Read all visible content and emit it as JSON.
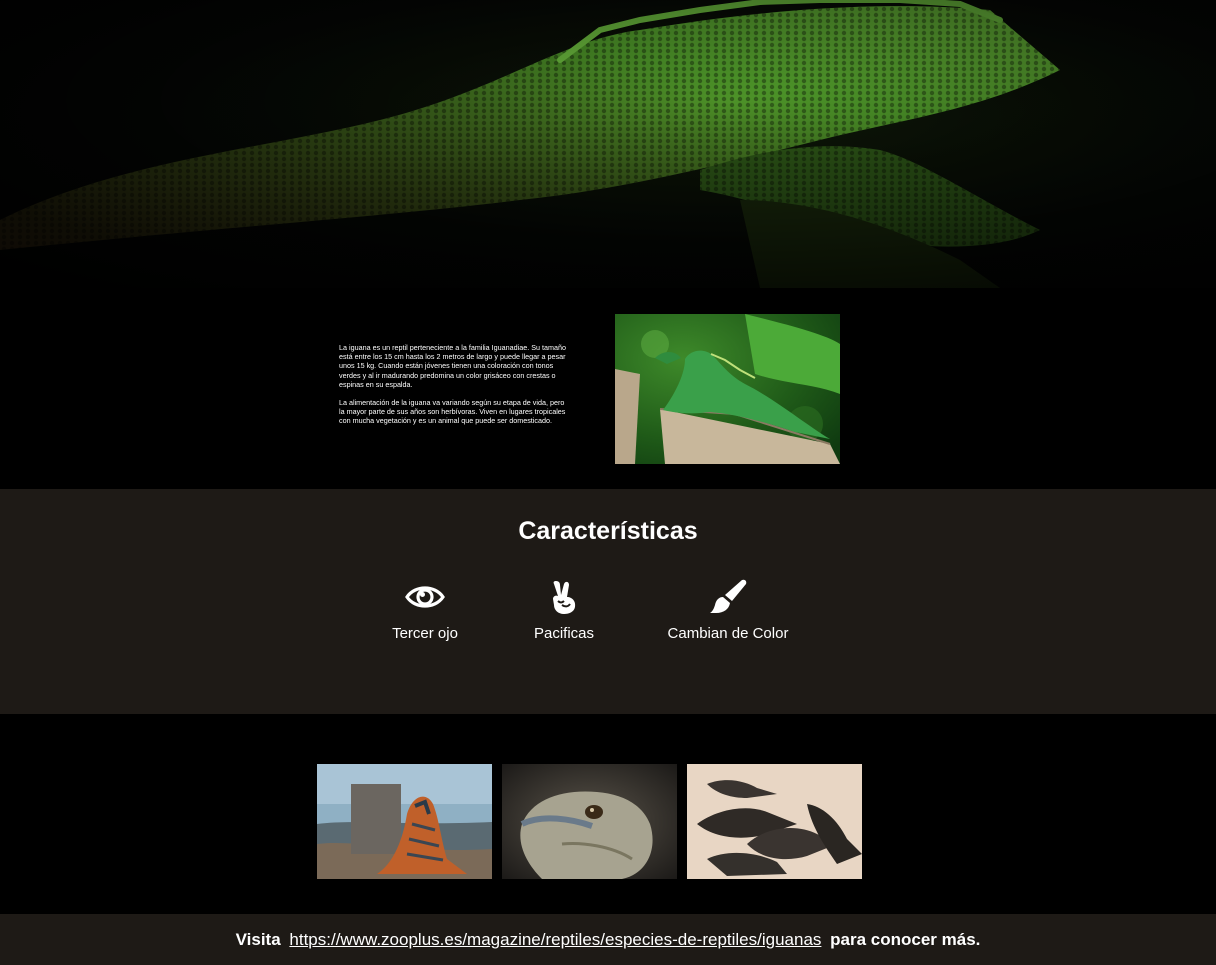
{
  "hero": {
    "image": "iguana-closeup"
  },
  "intro": {
    "paragraphs": [
      "La iguana es un reptil perteneciente a la familia Iguanadiae. Su tamaño está entre los 15 cm hasta los 2 metros de largo y puede llegar a pesar unos 15 kg. Cuando están jóvenes tienen una coloración con tonos verdes y al ir madurando predomina un color grisáceo con crestas o espinas en su espalda.",
      "La alimentación de la iguana va variando según su etapa de vida, pero la mayor parte de sus años son herbívoras. Viven en lugares tropicales con mucha vegetación y es un animal que puede ser domesticado."
    ],
    "image": "green-iguana-on-stump"
  },
  "features": {
    "title": "Características",
    "items": [
      {
        "icon": "eye-icon",
        "label": "Tercer ojo"
      },
      {
        "icon": "peace-hand-icon",
        "label": "Pacificas"
      },
      {
        "icon": "paint-brush-icon",
        "label": "Cambian de Color"
      }
    ]
  },
  "gallery": {
    "images": [
      "iguana-beach",
      "iguana-head",
      "marine-iguanas-sand"
    ]
  },
  "footer": {
    "prefix": "Visita",
    "link": "https://www.zooplus.es/magazine/reptiles/especies-de-reptiles/iguanas",
    "suffix": "para conocer más."
  },
  "colors": {
    "dark_band": "#1e1a16",
    "background": "#000000",
    "iguana_green": "#4f9a2a"
  }
}
